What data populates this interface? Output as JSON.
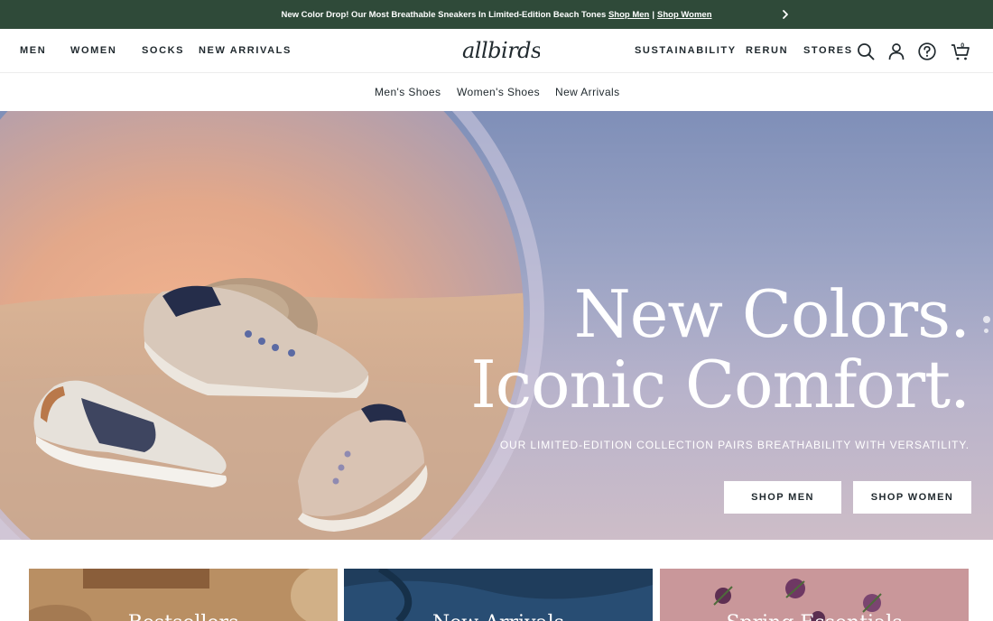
{
  "announcement": {
    "text": "New Color Drop! Our Most Breathable Sneakers In Limited-Edition Beach Tones",
    "link_men": "Shop Men",
    "separator": "|",
    "link_women": "Shop Women",
    "next_icon": "chevron-right-icon"
  },
  "nav": {
    "left": [
      "MEN",
      "WOMEN",
      "SOCKS",
      "NEW ARRIVALS"
    ],
    "logo_text": "allbirds",
    "right": [
      "SUSTAINABILITY",
      "RERUN",
      "STORES"
    ],
    "icons": [
      "search-icon",
      "account-icon",
      "help-icon",
      "cart-icon"
    ],
    "cart_count": "0"
  },
  "subnav": {
    "items": [
      "Men's Shoes",
      "Women's Shoes",
      "New Arrivals"
    ]
  },
  "hero": {
    "headline_line1": "New Colors.",
    "headline_line2": "Iconic Comfort.",
    "subtext": "OUR LIMITED-EDITION COLLECTION PAIRS BREATHABILITY WITH VERSATILITY.",
    "button_men": "SHOP MEN",
    "button_women": "SHOP WOMEN"
  },
  "cards": {
    "titles": [
      "Bestsellers",
      "New Arrivals",
      "Spring Essentials"
    ]
  },
  "colors": {
    "announcement_bg": "#2f4a39",
    "text": "#212a2f",
    "hero_sky": "#8a98c0"
  }
}
